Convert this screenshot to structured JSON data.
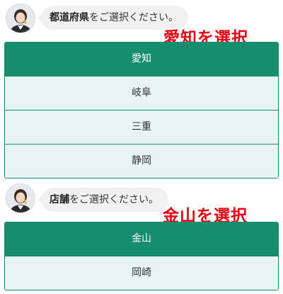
{
  "colors": {
    "accent": "#168d6e",
    "option_bg": "#e8f4f1",
    "annotation": "#e60012",
    "bubble_bg": "#f1f1f1"
  },
  "prefecture": {
    "avatar_icon": "operator-avatar-icon",
    "prompt_bold": "都道府県",
    "prompt_rest": "をご選択ください。",
    "annotation": "愛知を選択",
    "options": [
      {
        "label": "愛知",
        "selected": true
      },
      {
        "label": "岐阜",
        "selected": false
      },
      {
        "label": "三重",
        "selected": false
      },
      {
        "label": "静岡",
        "selected": false
      }
    ]
  },
  "store": {
    "avatar_icon": "operator-avatar-icon",
    "prompt_bold": "店舗",
    "prompt_rest": "をご選択ください。",
    "annotation": "金山を選択",
    "options": [
      {
        "label": "金山",
        "selected": true
      },
      {
        "label": "岡崎",
        "selected": false
      }
    ]
  }
}
